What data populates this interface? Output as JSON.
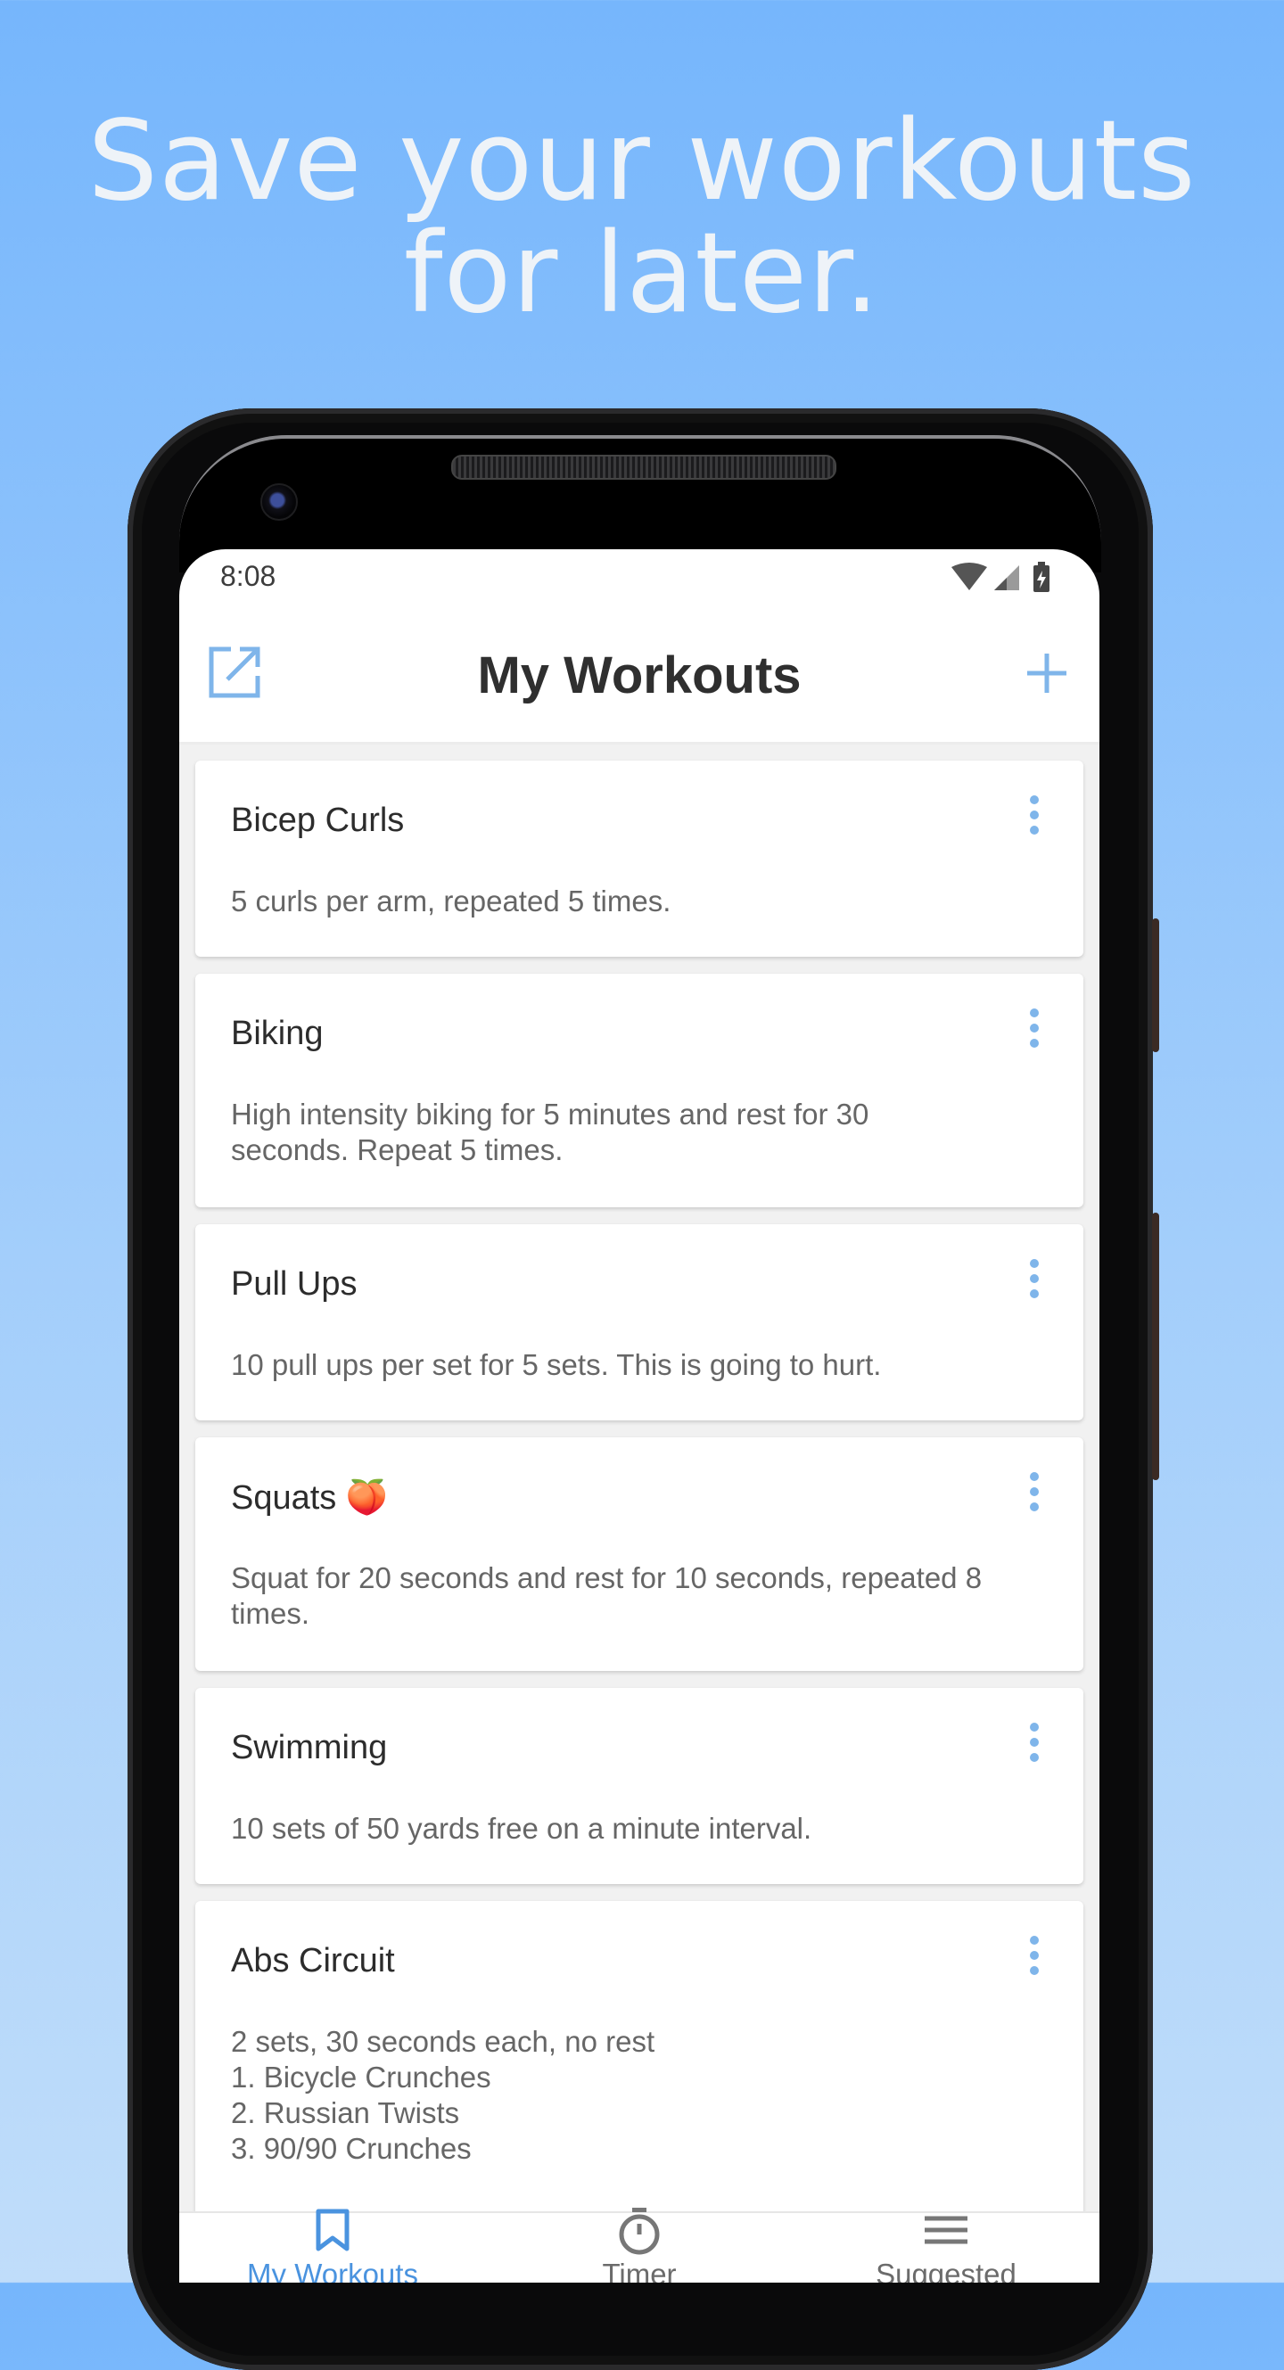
{
  "headline": {
    "line1": "Save your workouts",
    "line2": "for later."
  },
  "status_bar": {
    "time": "8:08"
  },
  "app_bar": {
    "title": "My Workouts"
  },
  "workouts": [
    {
      "title": "Bicep Curls",
      "description": "5 curls per arm, repeated 5 times."
    },
    {
      "title": "Biking",
      "description": "High intensity biking for 5 minutes and rest for 30\nseconds. Repeat 5 times."
    },
    {
      "title": "Pull Ups",
      "description": "10 pull ups per set for 5 sets. This is going to hurt."
    },
    {
      "title": "Squats 🍑",
      "description": "Squat for 20 seconds and rest for 10 seconds, repeated 8\ntimes."
    },
    {
      "title": "Swimming",
      "description": "10 sets of 50 yards free on a minute interval."
    },
    {
      "title": "Abs Circuit",
      "description": "2 sets, 30 seconds each, no rest\n1. Bicycle Crunches\n2. Russian Twists\n3. 90/90 Crunches"
    }
  ],
  "bottom_nav": {
    "items": [
      {
        "label": "My Workouts",
        "icon": "bookmark-icon",
        "active": true
      },
      {
        "label": "Timer",
        "icon": "stopwatch-icon",
        "active": false
      },
      {
        "label": "Suggested",
        "icon": "menu-icon",
        "active": false
      }
    ]
  },
  "colors": {
    "accent": "#4a93df",
    "icon_blue": "#7fb5ea",
    "background_top": "#76b6fc",
    "background_bottom": "#c0ddfa"
  }
}
